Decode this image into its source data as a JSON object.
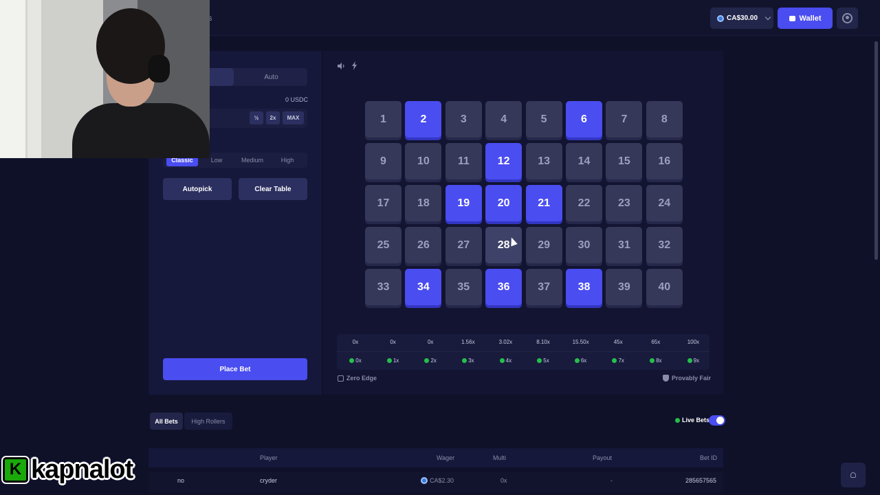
{
  "header": {
    "nav_fragment": "ts",
    "balance": "CA$30.00",
    "wallet_label": "Wallet"
  },
  "sidebar": {
    "mode_auto": "Auto",
    "balance_label": "0 USDC",
    "quick": {
      "half": "½",
      "double": "2x",
      "max": "MAX"
    },
    "risk_levels": [
      "Classic",
      "Low",
      "Medium",
      "High"
    ],
    "risk_selected": "Classic",
    "autopick_label": "Autopick",
    "clear_label": "Clear Table",
    "place_bet_label": "Place Bet"
  },
  "board": {
    "tiles": [
      1,
      2,
      3,
      4,
      5,
      6,
      7,
      8,
      9,
      10,
      11,
      12,
      13,
      14,
      15,
      16,
      17,
      18,
      19,
      20,
      21,
      22,
      23,
      24,
      25,
      26,
      27,
      28,
      29,
      30,
      31,
      32,
      33,
      34,
      35,
      36,
      37,
      38,
      39,
      40
    ],
    "selected": [
      2,
      6,
      12,
      19,
      20,
      21,
      34,
      36,
      38
    ],
    "hovered": 28
  },
  "payouts": {
    "multipliers": [
      "0x",
      "0x",
      "0x",
      "1.56x",
      "3.02x",
      "8.10x",
      "15.50x",
      "45x",
      "65x",
      "100x"
    ],
    "hits": [
      "0x",
      "1x",
      "2x",
      "3x",
      "4x",
      "5x",
      "6x",
      "7x",
      "8x",
      "9x"
    ],
    "zero_edge": "Zero Edge",
    "provably_fair": "Provably Fair"
  },
  "bets": {
    "tabs": [
      "All Bets",
      "High Rollers"
    ],
    "live_label": "Live Bets",
    "headers": {
      "player": "Player",
      "wager": "Wager",
      "multi": "Multi",
      "payout": "Payout",
      "bet_id": "Bet ID"
    },
    "row": {
      "game": "no",
      "player": "cryder",
      "wager": "CA$2.30",
      "multi": "0x",
      "payout": "-",
      "bet_id": "285657565"
    }
  },
  "overlay": {
    "logo_letter": "K",
    "logo_text": "kapnalot"
  },
  "colors": {
    "accent": "#4a4df0",
    "tile": "#353859",
    "background": "#0f1129",
    "gem": "#25c04a"
  }
}
